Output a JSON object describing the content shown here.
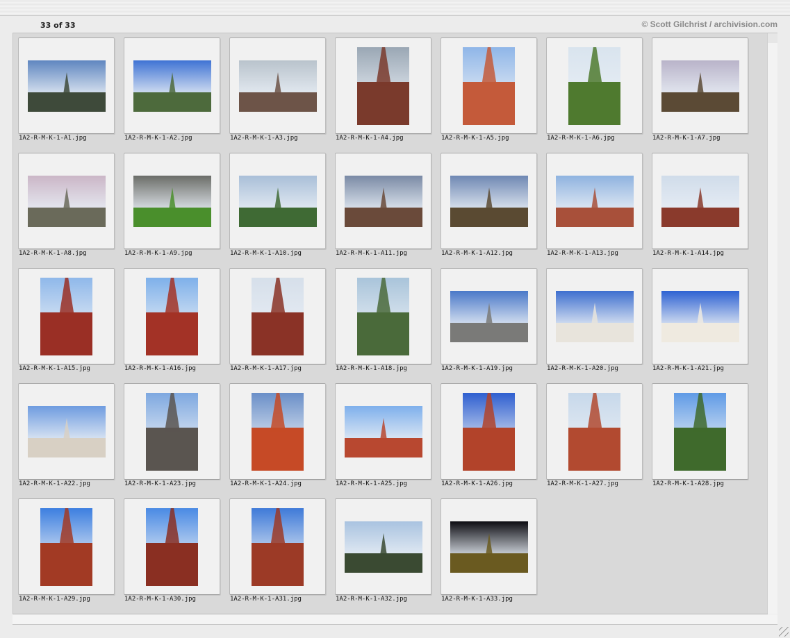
{
  "header": {
    "counter": "33 of 33",
    "copyright": "© Scott Gilchrist / archivision.com"
  },
  "thumbnails": [
    {
      "file": "1A2-R-M-K-1-A1.jpg",
      "orientation": "landscape",
      "sky": "#5f86c0",
      "ground": "#3e4a3a"
    },
    {
      "file": "1A2-R-M-K-1-A2.jpg",
      "orientation": "landscape",
      "sky": "#3f73d4",
      "ground": "#4d6a3c"
    },
    {
      "file": "1A2-R-M-K-1-A3.jpg",
      "orientation": "landscape",
      "sky": "#b9c3cc",
      "ground": "#6d5448"
    },
    {
      "file": "1A2-R-M-K-1-A4.jpg",
      "orientation": "portrait",
      "sky": "#9aa7b4",
      "ground": "#7a3a2c"
    },
    {
      "file": "1A2-R-M-K-1-A5.jpg",
      "orientation": "portrait",
      "sky": "#8fb6e8",
      "ground": "#c45a3a"
    },
    {
      "file": "1A2-R-M-K-1-A6.jpg",
      "orientation": "portrait",
      "sky": "#d9e4ee",
      "ground": "#4f7a2f"
    },
    {
      "file": "1A2-R-M-K-1-A7.jpg",
      "orientation": "landscape",
      "sky": "#b9b3c9",
      "ground": "#5b4a35"
    },
    {
      "file": "1A2-R-M-K-1-A8.jpg",
      "orientation": "landscape",
      "sky": "#cbb6c7",
      "ground": "#6a6a5a"
    },
    {
      "file": "1A2-R-M-K-1-A9.jpg",
      "orientation": "landscape",
      "sky": "#6b6d68",
      "ground": "#4a8f2c"
    },
    {
      "file": "1A2-R-M-K-1-A10.jpg",
      "orientation": "landscape",
      "sky": "#a9bfd8",
      "ground": "#3f6a34"
    },
    {
      "file": "1A2-R-M-K-1-A11.jpg",
      "orientation": "landscape",
      "sky": "#7a8aa5",
      "ground": "#6a4a3a"
    },
    {
      "file": "1A2-R-M-K-1-A12.jpg",
      "orientation": "landscape",
      "sky": "#6f88b3",
      "ground": "#5a4a32"
    },
    {
      "file": "1A2-R-M-K-1-A13.jpg",
      "orientation": "landscape",
      "sky": "#8fb3e0",
      "ground": "#a8503a"
    },
    {
      "file": "1A2-R-M-K-1-A14.jpg",
      "orientation": "landscape",
      "sky": "#d0dcea",
      "ground": "#8a3a2c"
    },
    {
      "file": "1A2-R-M-K-1-A15.jpg",
      "orientation": "portrait",
      "sky": "#8fb8ea",
      "ground": "#9a2f25"
    },
    {
      "file": "1A2-R-M-K-1-A16.jpg",
      "orientation": "portrait",
      "sky": "#7eb0ea",
      "ground": "#a33226"
    },
    {
      "file": "1A2-R-M-K-1-A17.jpg",
      "orientation": "portrait",
      "sky": "#d6dfea",
      "ground": "#8a3226"
    },
    {
      "file": "1A2-R-M-K-1-A18.jpg",
      "orientation": "portrait",
      "sky": "#a9c4da",
      "ground": "#4a6a3a"
    },
    {
      "file": "1A2-R-M-K-1-A19.jpg",
      "orientation": "landscape",
      "sky": "#4a78c8",
      "ground": "#7a7a78"
    },
    {
      "file": "1A2-R-M-K-1-A20.jpg",
      "orientation": "landscape",
      "sky": "#3e6fcf",
      "ground": "#e8e4dc"
    },
    {
      "file": "1A2-R-M-K-1-A21.jpg",
      "orientation": "landscape",
      "sky": "#2e62d2",
      "ground": "#efeae0"
    },
    {
      "file": "1A2-R-M-K-1-A22.jpg",
      "orientation": "landscape",
      "sky": "#6f9ce0",
      "ground": "#d8d0c4"
    },
    {
      "file": "1A2-R-M-K-1-A23.jpg",
      "orientation": "portrait",
      "sky": "#7ea8e0",
      "ground": "#5a5550"
    },
    {
      "file": "1A2-R-M-K-1-A24.jpg",
      "orientation": "portrait",
      "sky": "#6a8fc8",
      "ground": "#c64a26"
    },
    {
      "file": "1A2-R-M-K-1-A25.jpg",
      "orientation": "landscape",
      "sky": "#7fb0ec",
      "ground": "#b84830"
    },
    {
      "file": "1A2-R-M-K-1-A26.jpg",
      "orientation": "portrait",
      "sky": "#2f5fd0",
      "ground": "#b2432a"
    },
    {
      "file": "1A2-R-M-K-1-A27.jpg",
      "orientation": "portrait",
      "sky": "#c7d8ea",
      "ground": "#b24a30"
    },
    {
      "file": "1A2-R-M-K-1-A28.jpg",
      "orientation": "portrait",
      "sky": "#5f9ae6",
      "ground": "#3f6a2c"
    },
    {
      "file": "1A2-R-M-K-1-A29.jpg",
      "orientation": "portrait",
      "sky": "#3d7fe0",
      "ground": "#a23a24"
    },
    {
      "file": "1A2-R-M-K-1-A30.jpg",
      "orientation": "portrait",
      "sky": "#4a8ae4",
      "ground": "#8a2f22"
    },
    {
      "file": "1A2-R-M-K-1-A31.jpg",
      "orientation": "portrait",
      "sky": "#3f7ad8",
      "ground": "#9c3a26"
    },
    {
      "file": "1A2-R-M-K-1-A32.jpg",
      "orientation": "landscape",
      "sky": "#a9c3e0",
      "ground": "#3a4a32"
    },
    {
      "file": "1A2-R-M-K-1-A33.jpg",
      "orientation": "landscape",
      "sky": "#0c0c12",
      "ground": "#6a5a20"
    }
  ]
}
